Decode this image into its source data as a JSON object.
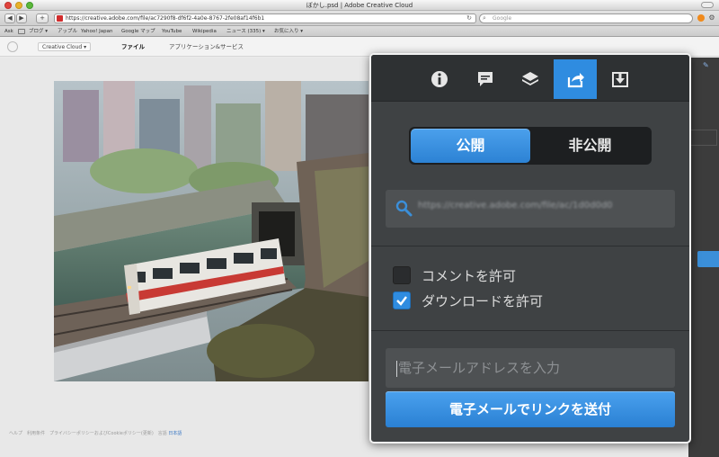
{
  "window": {
    "title": "ぼかし.psd | Adobe Creative Cloud"
  },
  "toolbar": {
    "back": "◀",
    "forward": "▶",
    "add_tab": "+",
    "url": "https://creative.adobe.com/file/ac7290f8-df6f2-4a0e-8767-2fe08af14f6b1",
    "search_placeholder": "Google"
  },
  "bookmarks": [
    "Ask",
    "ブログ ▾",
    "アップル",
    "Yahoo! Japan",
    "Google マップ",
    "YouTube",
    "Wikipedia",
    "ニュース (335) ▾",
    "お気に入り ▾"
  ],
  "app_header": {
    "account": "Creative Cloud ▾",
    "nav": [
      "ファイル",
      "アプリケーション&サービス"
    ]
  },
  "footer": {
    "links": "ヘルプ　利用条件　プライバシーポリシーおよびCookieポリシー(更新)　言語",
    "language": "日本語"
  },
  "popover": {
    "tabs": [
      {
        "icon": "info-icon",
        "active": false
      },
      {
        "icon": "comment-icon",
        "active": false
      },
      {
        "icon": "layers-icon",
        "active": false
      },
      {
        "icon": "share-icon",
        "active": true
      },
      {
        "icon": "download-icon",
        "active": false
      }
    ],
    "toggle": {
      "public_label": "公開",
      "private_label": "非公開",
      "selected": "公開"
    },
    "link_url": "https://creative.adobe.com/file/ac/1d0d0d0",
    "allow_comments": {
      "label": "コメントを許可",
      "checked": false
    },
    "allow_download": {
      "label": "ダウンロードを許可",
      "checked": true
    },
    "email_placeholder": "電子メールアドレスを入力",
    "send_button": "電子メールでリンクを送付"
  },
  "colors": {
    "accent": "#2f8ce0",
    "popover_bg": "#3f4244"
  }
}
